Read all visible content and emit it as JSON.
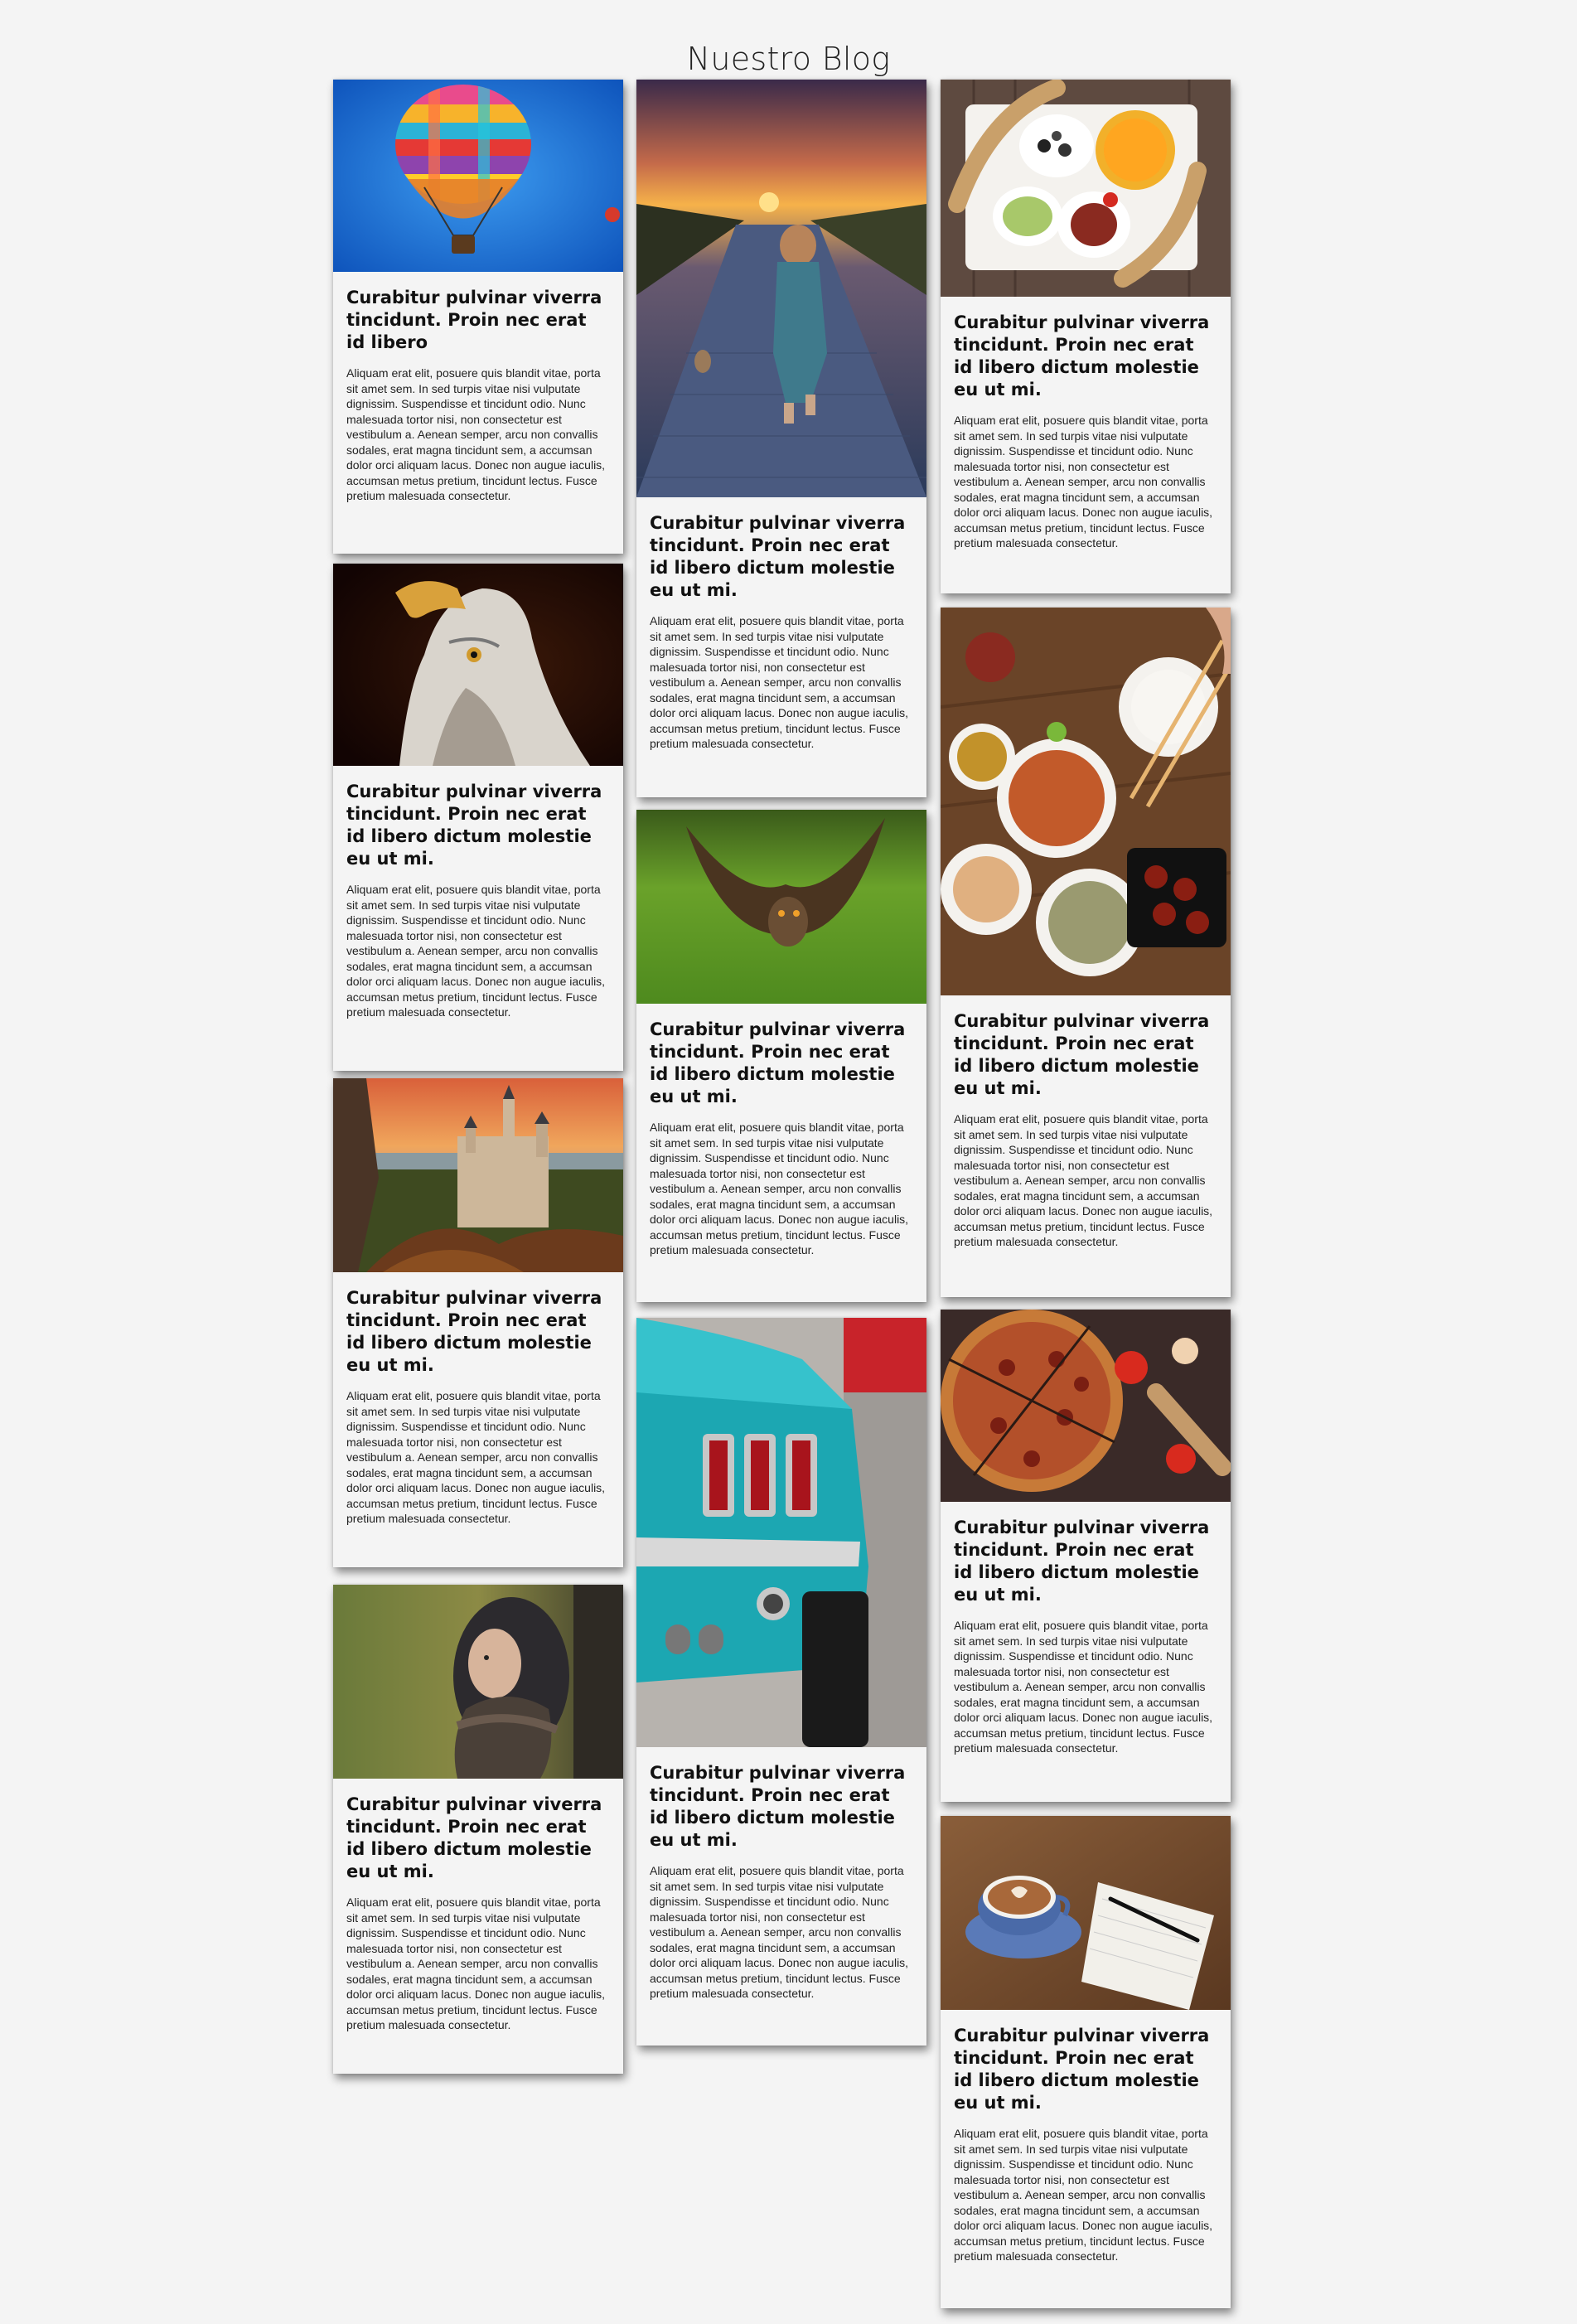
{
  "header": {
    "title": "Nuestro Blog"
  },
  "posts": [
    {
      "title": "Curabitur pulvinar viverra tincidunt. Proin nec erat id libero",
      "text": "Aliquam erat elit, posuere quis blandit vitae, porta sit amet sem. In sed turpis vitae nisi vulputate dignissim. Suspendisse et tincidunt odio. Nunc malesuada tortor nisi, non consectetur est vestibulum a. Aenean semper, arcu non convallis sodales, erat magna tincidunt sem, a accumsan dolor orci aliquam lacus. Donec non augue iaculis, accumsan metus pretium, tincidunt lectus. Fusce pretium malesuada consectetur.",
      "image": "hot-air-balloon-image"
    },
    {
      "title": "Curabitur pulvinar viverra tincidunt. Proin nec erat id libero dictum molestie eu ut mi.",
      "text": "Aliquam erat elit, posuere quis blandit vitae, porta sit amet sem. In sed turpis vitae nisi vulputate dignissim. Suspendisse et tincidunt odio. Nunc malesuada tortor nisi, non consectetur est vestibulum a. Aenean semper, arcu non convallis sodales, erat magna tincidunt sem, a accumsan dolor orci aliquam lacus. Donec non augue iaculis, accumsan metus pretium, tincidunt lectus. Fusce pretium malesuada consectetur.",
      "image": "eagle-image"
    },
    {
      "title": "Curabitur pulvinar viverra tincidunt. Proin nec erat id libero dictum molestie eu ut mi.",
      "text": "Aliquam erat elit, posuere quis blandit vitae, porta sit amet sem. In sed turpis vitae nisi vulputate dignissim. Suspendisse et tincidunt odio. Nunc malesuada tortor nisi, non consectetur est vestibulum a. Aenean semper, arcu non convallis sodales, erat magna tincidunt sem, a accumsan dolor orci aliquam lacus. Donec non augue iaculis, accumsan metus pretium, tincidunt lectus. Fusce pretium malesuada consectetur.",
      "image": "castle-image"
    },
    {
      "title": "Curabitur pulvinar viverra tincidunt. Proin nec erat id libero dictum molestie eu ut mi.",
      "text": "Aliquam erat elit, posuere quis blandit vitae, porta sit amet sem. In sed turpis vitae nisi vulputate dignissim. Suspendisse et tincidunt odio. Nunc malesuada tortor nisi, non consectetur est vestibulum a. Aenean semper, arcu non convallis sodales, erat magna tincidunt sem, a accumsan dolor orci aliquam lacus. Donec non augue iaculis, accumsan metus pretium, tincidunt lectus. Fusce pretium malesuada consectetur.",
      "image": "woman-scarf-image"
    },
    {
      "title": "Curabitur pulvinar viverra tincidunt. Proin nec erat id libero dictum molestie eu ut mi.",
      "text": "Aliquam erat elit, posuere quis blandit vitae, porta sit amet sem. In sed turpis vitae nisi vulputate dignissim. Suspendisse et tincidunt odio. Nunc malesuada tortor nisi, non consectetur est vestibulum a. Aenean semper, arcu non convallis sodales, erat magna tincidunt sem, a accumsan dolor orci aliquam lacus. Donec non augue iaculis, accumsan metus pretium, tincidunt lectus. Fusce pretium malesuada consectetur.",
      "image": "child-sunset-road-image"
    },
    {
      "title": "Curabitur pulvinar viverra tincidunt. Proin nec erat id libero dictum molestie eu ut mi.",
      "text": "Aliquam erat elit, posuere quis blandit vitae, porta sit amet sem. In sed turpis vitae nisi vulputate dignissim. Suspendisse et tincidunt odio. Nunc malesuada tortor nisi, non consectetur est vestibulum a. Aenean semper, arcu non convallis sodales, erat magna tincidunt sem, a accumsan dolor orci aliquam lacus. Donec non augue iaculis, accumsan metus pretium, tincidunt lectus. Fusce pretium malesuada consectetur.",
      "image": "owl-flying-image"
    },
    {
      "title": "Curabitur pulvinar viverra tincidunt. Proin nec erat id libero dictum molestie eu ut mi.",
      "text": "Aliquam erat elit, posuere quis blandit vitae, porta sit amet sem. In sed turpis vitae nisi vulputate dignissim. Suspendisse et tincidunt odio. Nunc malesuada tortor nisi, non consectetur est vestibulum a. Aenean semper, arcu non convallis sodales, erat magna tincidunt sem, a accumsan dolor orci aliquam lacus. Donec non augue iaculis, accumsan metus pretium, tincidunt lectus. Fusce pretium malesuada consectetur.",
      "image": "classic-car-image"
    },
    {
      "title": "Curabitur pulvinar viverra tincidunt. Proin nec erat id libero dictum molestie eu ut mi.",
      "text": "Aliquam erat elit, posuere quis blandit vitae, porta sit amet sem. In sed turpis vitae nisi vulputate dignissim. Suspendisse et tincidunt odio. Nunc malesuada tortor nisi, non consectetur est vestibulum a. Aenean semper, arcu non convallis sodales, erat magna tincidunt sem, a accumsan dolor orci aliquam lacus. Donec non augue iaculis, accumsan metus pretium, tincidunt lectus. Fusce pretium malesuada consectetur.",
      "image": "breakfast-plate-image"
    },
    {
      "title": "Curabitur pulvinar viverra tincidunt. Proin nec erat id libero dictum molestie eu ut mi.",
      "text": "Aliquam erat elit, posuere quis blandit vitae, porta sit amet sem. In sed turpis vitae nisi vulputate dignissim. Suspendisse et tincidunt odio. Nunc malesuada tortor nisi, non consectetur est vestibulum a. Aenean semper, arcu non convallis sodales, erat magna tincidunt sem, a accumsan dolor orci aliquam lacus. Donec non augue iaculis, accumsan metus pretium, tincidunt lectus. Fusce pretium malesuada consectetur.",
      "image": "asian-food-table-image"
    },
    {
      "title": "Curabitur pulvinar viverra tincidunt. Proin nec erat id libero dictum molestie eu ut mi.",
      "text": "Aliquam erat elit, posuere quis blandit vitae, porta sit amet sem. In sed turpis vitae nisi vulputate dignissim. Suspendisse et tincidunt odio. Nunc malesuada tortor nisi, non consectetur est vestibulum a. Aenean semper, arcu non convallis sodales, erat magna tincidunt sem, a accumsan dolor orci aliquam lacus. Donec non augue iaculis, accumsan metus pretium, tincidunt lectus. Fusce pretium malesuada consectetur.",
      "image": "pizza-image"
    },
    {
      "title": "Curabitur pulvinar viverra tincidunt. Proin nec erat id libero dictum molestie eu ut mi.",
      "text": "Aliquam erat elit, posuere quis blandit vitae, porta sit amet sem. In sed turpis vitae nisi vulputate dignissim. Suspendisse et tincidunt odio. Nunc malesuada tortor nisi, non consectetur est vestibulum a. Aenean semper, arcu non convallis sodales, erat magna tincidunt sem, a accumsan dolor orci aliquam lacus. Donec non augue iaculis, accumsan metus pretium, tincidunt lectus. Fusce pretium malesuada consectetur.",
      "image": "coffee-notebook-image"
    }
  ]
}
